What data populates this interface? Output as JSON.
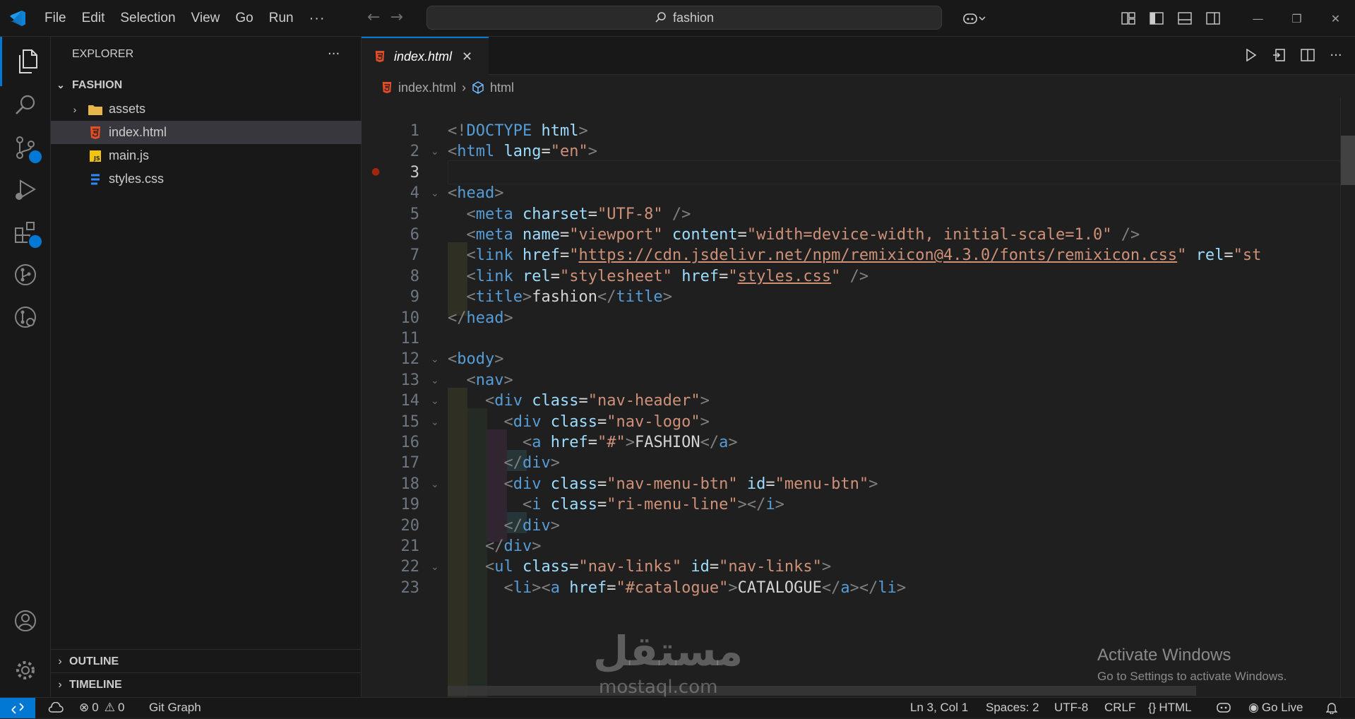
{
  "titlebar": {
    "menu": [
      "File",
      "Edit",
      "Selection",
      "View",
      "Go",
      "Run",
      "···"
    ],
    "search_text": "fashion"
  },
  "sidebar": {
    "title": "EXPLORER",
    "more": "···",
    "folder": "FASHION",
    "items": [
      {
        "label": "assets",
        "kind": "folder"
      },
      {
        "label": "index.html",
        "kind": "html",
        "selected": true
      },
      {
        "label": "main.js",
        "kind": "js"
      },
      {
        "label": "styles.css",
        "kind": "css"
      }
    ],
    "sections": [
      "OUTLINE",
      "TIMELINE"
    ]
  },
  "editor": {
    "tab": "index.html",
    "breadcrumb": [
      "index.html",
      "html"
    ],
    "lines": [
      [
        [
          "g",
          "<!"
        ],
        [
          "t",
          "DOCTYPE"
        ],
        [
          "w",
          " "
        ],
        [
          "a",
          "html"
        ],
        [
          "g",
          ">"
        ]
      ],
      [
        [
          "g",
          "<"
        ],
        [
          "t",
          "html"
        ],
        [
          "w",
          " "
        ],
        [
          "a",
          "lang"
        ],
        [
          "w",
          "="
        ],
        [
          "s",
          "\"en\""
        ],
        [
          "g",
          ">"
        ]
      ],
      [],
      [
        [
          "g",
          "<"
        ],
        [
          "t",
          "head"
        ],
        [
          "g",
          ">"
        ]
      ],
      [
        [
          "w",
          "  "
        ],
        [
          "g",
          "<"
        ],
        [
          "t",
          "meta"
        ],
        [
          "w",
          " "
        ],
        [
          "a",
          "charset"
        ],
        [
          "w",
          "="
        ],
        [
          "s",
          "\"UTF-8\""
        ],
        [
          "w",
          " "
        ],
        [
          "g",
          "/>"
        ]
      ],
      [
        [
          "w",
          "  "
        ],
        [
          "g",
          "<"
        ],
        [
          "t",
          "meta"
        ],
        [
          "w",
          " "
        ],
        [
          "a",
          "name"
        ],
        [
          "w",
          "="
        ],
        [
          "s",
          "\"viewport\""
        ],
        [
          "w",
          " "
        ],
        [
          "a",
          "content"
        ],
        [
          "w",
          "="
        ],
        [
          "s",
          "\"width=device-width, initial-scale=1.0\""
        ],
        [
          "w",
          " "
        ],
        [
          "g",
          "/>"
        ]
      ],
      [
        [
          "w",
          "  "
        ],
        [
          "g",
          "<"
        ],
        [
          "t",
          "link"
        ],
        [
          "w",
          " "
        ],
        [
          "a",
          "href"
        ],
        [
          "w",
          "="
        ],
        [
          "s",
          "\""
        ],
        [
          "u",
          "https://cdn.jsdelivr.net/npm/remixicon@4.3.0/fonts/remixicon.css"
        ],
        [
          "s",
          "\""
        ],
        [
          "w",
          " "
        ],
        [
          "a",
          "rel"
        ],
        [
          "w",
          "="
        ],
        [
          "s",
          "\"st"
        ]
      ],
      [
        [
          "w",
          "  "
        ],
        [
          "g",
          "<"
        ],
        [
          "t",
          "link"
        ],
        [
          "w",
          " "
        ],
        [
          "a",
          "rel"
        ],
        [
          "w",
          "="
        ],
        [
          "s",
          "\"stylesheet\""
        ],
        [
          "w",
          " "
        ],
        [
          "a",
          "href"
        ],
        [
          "w",
          "="
        ],
        [
          "s",
          "\""
        ],
        [
          "u",
          "styles.css"
        ],
        [
          "s",
          "\""
        ],
        [
          "w",
          " "
        ],
        [
          "g",
          "/>"
        ]
      ],
      [
        [
          "w",
          "  "
        ],
        [
          "g",
          "<"
        ],
        [
          "t",
          "title"
        ],
        [
          "g",
          ">"
        ],
        [
          "w",
          "fashion"
        ],
        [
          "g",
          "</"
        ],
        [
          "t",
          "title"
        ],
        [
          "g",
          ">"
        ]
      ],
      [
        [
          "g",
          "</"
        ],
        [
          "t",
          "head"
        ],
        [
          "g",
          ">"
        ]
      ],
      [],
      [
        [
          "g",
          "<"
        ],
        [
          "t",
          "body"
        ],
        [
          "g",
          ">"
        ]
      ],
      [
        [
          "w",
          "  "
        ],
        [
          "g",
          "<"
        ],
        [
          "t",
          "nav"
        ],
        [
          "g",
          ">"
        ]
      ],
      [
        [
          "w",
          "    "
        ],
        [
          "g",
          "<"
        ],
        [
          "t",
          "div"
        ],
        [
          "w",
          " "
        ],
        [
          "a",
          "class"
        ],
        [
          "w",
          "="
        ],
        [
          "s",
          "\"nav-header\""
        ],
        [
          "g",
          ">"
        ]
      ],
      [
        [
          "w",
          "      "
        ],
        [
          "g",
          "<"
        ],
        [
          "t",
          "div"
        ],
        [
          "w",
          " "
        ],
        [
          "a",
          "class"
        ],
        [
          "w",
          "="
        ],
        [
          "s",
          "\"nav-logo\""
        ],
        [
          "g",
          ">"
        ]
      ],
      [
        [
          "w",
          "        "
        ],
        [
          "g",
          "<"
        ],
        [
          "t",
          "a"
        ],
        [
          "w",
          " "
        ],
        [
          "a",
          "href"
        ],
        [
          "w",
          "="
        ],
        [
          "s",
          "\"#\""
        ],
        [
          "g",
          ">"
        ],
        [
          "w",
          "FASHION"
        ],
        [
          "g",
          "</"
        ],
        [
          "t",
          "a"
        ],
        [
          "g",
          ">"
        ]
      ],
      [
        [
          "w",
          "      "
        ],
        [
          "g",
          "</"
        ],
        [
          "t",
          "div"
        ],
        [
          "g",
          ">"
        ]
      ],
      [
        [
          "w",
          "      "
        ],
        [
          "g",
          "<"
        ],
        [
          "t",
          "div"
        ],
        [
          "w",
          " "
        ],
        [
          "a",
          "class"
        ],
        [
          "w",
          "="
        ],
        [
          "s",
          "\"nav-menu-btn\""
        ],
        [
          "w",
          " "
        ],
        [
          "a",
          "id"
        ],
        [
          "w",
          "="
        ],
        [
          "s",
          "\"menu-btn\""
        ],
        [
          "g",
          ">"
        ]
      ],
      [
        [
          "w",
          "        "
        ],
        [
          "g",
          "<"
        ],
        [
          "t",
          "i"
        ],
        [
          "w",
          " "
        ],
        [
          "a",
          "class"
        ],
        [
          "w",
          "="
        ],
        [
          "s",
          "\"ri-menu-line\""
        ],
        [
          "g",
          "></"
        ],
        [
          "t",
          "i"
        ],
        [
          "g",
          ">"
        ]
      ],
      [
        [
          "w",
          "      "
        ],
        [
          "g",
          "</"
        ],
        [
          "t",
          "div"
        ],
        [
          "g",
          ">"
        ]
      ],
      [
        [
          "w",
          "    "
        ],
        [
          "g",
          "</"
        ],
        [
          "t",
          "div"
        ],
        [
          "g",
          ">"
        ]
      ],
      [
        [
          "w",
          "    "
        ],
        [
          "g",
          "<"
        ],
        [
          "t",
          "ul"
        ],
        [
          "w",
          " "
        ],
        [
          "a",
          "class"
        ],
        [
          "w",
          "="
        ],
        [
          "s",
          "\"nav-links\""
        ],
        [
          "w",
          " "
        ],
        [
          "a",
          "id"
        ],
        [
          "w",
          "="
        ],
        [
          "s",
          "\"nav-links\""
        ],
        [
          "g",
          ">"
        ]
      ],
      [
        [
          "w",
          "      "
        ],
        [
          "g",
          "<"
        ],
        [
          "t",
          "li"
        ],
        [
          "g",
          "><"
        ],
        [
          "t",
          "a"
        ],
        [
          "w",
          " "
        ],
        [
          "a",
          "href"
        ],
        [
          "w",
          "="
        ],
        [
          "s",
          "\"#catalogue\""
        ],
        [
          "g",
          ">"
        ],
        [
          "w",
          "CATALOGUE"
        ],
        [
          "g",
          "</"
        ],
        [
          "t",
          "a"
        ],
        [
          "g",
          "></"
        ],
        [
          "t",
          "li"
        ],
        [
          "g",
          ">"
        ]
      ]
    ],
    "current_line": 3,
    "breakpoint_line": 3,
    "fold_lines": [
      2,
      4,
      12,
      13,
      14,
      15,
      18,
      22
    ]
  },
  "watermark": {
    "line1": "Activate Windows",
    "line2": "Go to Settings to activate Windows.",
    "logo": "مستقل",
    "logo_sub": "mostaql.com"
  },
  "statusbar": {
    "errors": "0",
    "warnings": "0",
    "git_graph": "Git Graph",
    "position": "Ln 3, Col 1",
    "spaces": "Spaces: 2",
    "encoding": "UTF-8",
    "eol": "CRLF",
    "language": "HTML",
    "golive": "Go Live"
  },
  "colors": {
    "accent": "#0078d4",
    "html_icon": "#e44d26",
    "js_icon": "#f1c40f",
    "css_icon": "#2e8bff",
    "folder": "#e8b54a"
  }
}
